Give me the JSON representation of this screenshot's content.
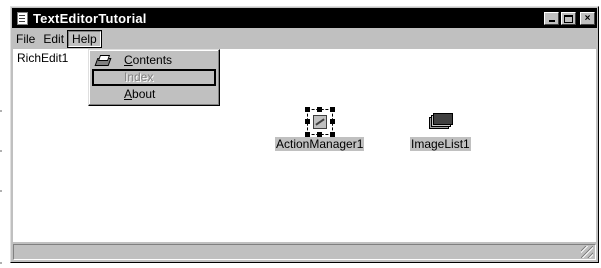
{
  "window": {
    "title": "TextEditorTutorial",
    "close_glyph": "×"
  },
  "menubar": {
    "items": [
      "File",
      "Edit",
      "Help"
    ]
  },
  "help_menu": {
    "items": [
      {
        "label": "Contents",
        "accel": "C",
        "rest": "ontents",
        "state": "enabled",
        "icon": "book-icon"
      },
      {
        "label": "Index",
        "state": "disabled",
        "focused": true
      },
      {
        "label": "About",
        "accel": "A",
        "rest": "bout",
        "state": "enabled"
      }
    ]
  },
  "form": {
    "richedit_label": "RichEdit1",
    "components": [
      {
        "name": "ActionManager1",
        "icon": "action-manager-icon",
        "selected": true
      },
      {
        "name": "ImageList1",
        "icon": "image-list-icon",
        "selected": false
      }
    ]
  },
  "colors": {
    "title_bg": "#000000",
    "face": "#c0c0c0",
    "client": "#ffffff"
  }
}
